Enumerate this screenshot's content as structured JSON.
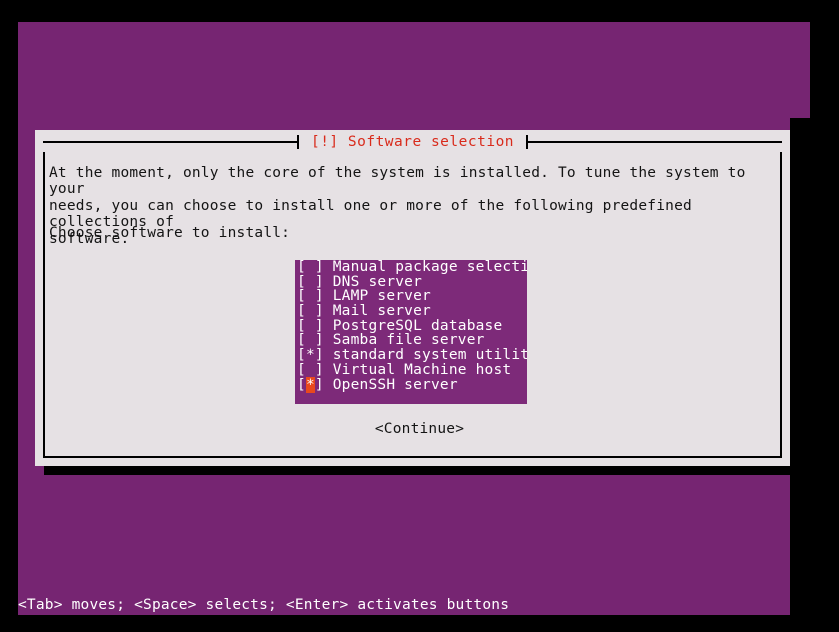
{
  "colors": {
    "backdrop_purple": "#762572",
    "list_purple": "#7d2a79",
    "dialog_bg": "#e6e1e4",
    "title_red": "#d92b1c",
    "cursor_orange": "#e8491d",
    "text_black": "#141414",
    "text_white": "#ffffff",
    "frame_black": "#000000"
  },
  "dialog": {
    "title": "[!] Software selection",
    "body": "At the moment, only the core of the system is installed. To tune the system to your\nneeds, you can choose to install one or more of the following predefined collections of\nsoftware.",
    "prompt": "Choose software to install:",
    "continue_label": "<Continue>"
  },
  "software_list": [
    {
      "label": "Manual package selection",
      "checked": false,
      "cursor": false,
      "checkbox": "[ ]"
    },
    {
      "label": "DNS server",
      "checked": false,
      "cursor": false,
      "checkbox": "[ ]"
    },
    {
      "label": "LAMP server",
      "checked": false,
      "cursor": false,
      "checkbox": "[ ]"
    },
    {
      "label": "Mail server",
      "checked": false,
      "cursor": false,
      "checkbox": "[ ]"
    },
    {
      "label": "PostgreSQL database",
      "checked": false,
      "cursor": false,
      "checkbox": "[ ]"
    },
    {
      "label": "Samba file server",
      "checked": false,
      "cursor": false,
      "checkbox": "[ ]"
    },
    {
      "label": "standard system utilities",
      "checked": true,
      "cursor": false,
      "checkbox": "[*]"
    },
    {
      "label": "Virtual Machine host",
      "checked": false,
      "cursor": false,
      "checkbox": "[ ]"
    },
    {
      "label": "OpenSSH server",
      "checked": true,
      "cursor": true,
      "checkbox": "[*]"
    }
  ],
  "footer": {
    "hint": "<Tab> moves; <Space> selects; <Enter> activates buttons"
  }
}
